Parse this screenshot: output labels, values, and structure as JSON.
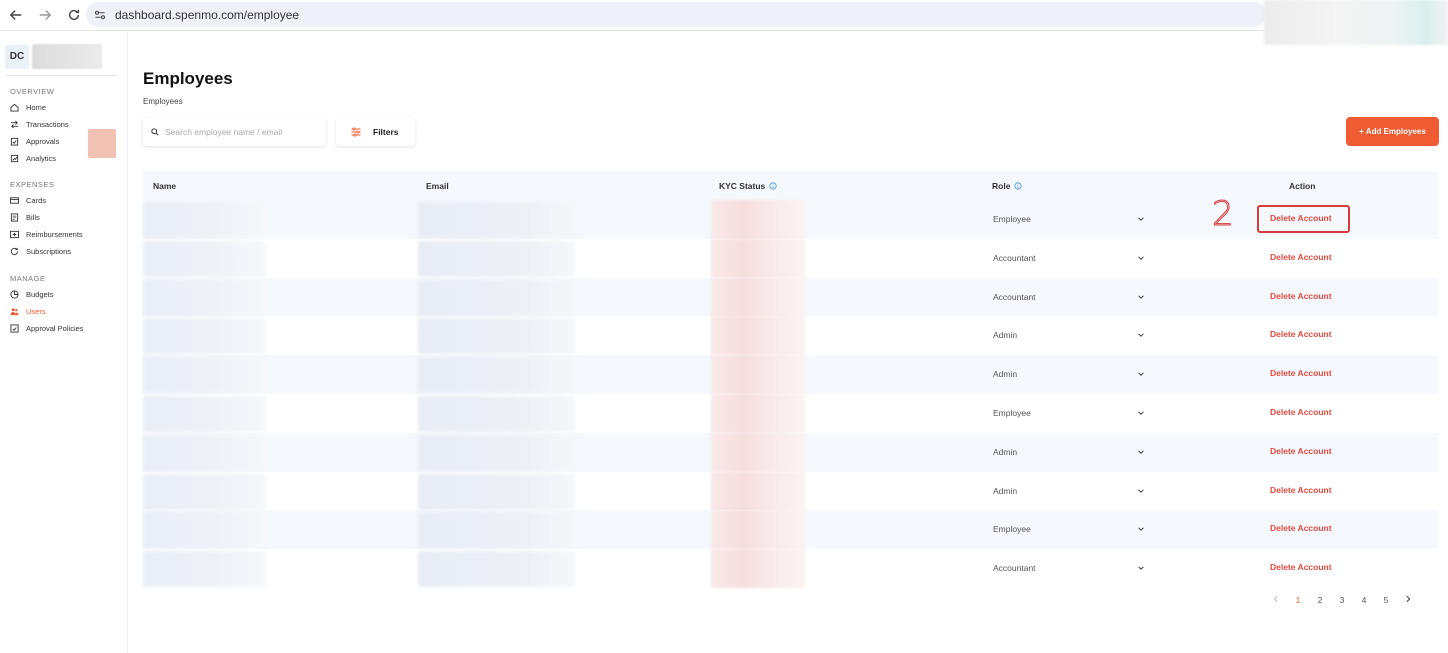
{
  "browser": {
    "url": "dashboard.spenmo.com/employee"
  },
  "sidebar": {
    "org_initials": "DC",
    "sections": [
      {
        "title": "OVERVIEW",
        "items": [
          {
            "label": "Home",
            "icon": "home-icon"
          },
          {
            "label": "Transactions",
            "icon": "transactions-icon"
          },
          {
            "label": "Approvals",
            "icon": "approvals-icon"
          },
          {
            "label": "Analytics",
            "icon": "analytics-icon"
          }
        ]
      },
      {
        "title": "EXPENSES",
        "items": [
          {
            "label": "Cards",
            "icon": "card-icon"
          },
          {
            "label": "Bills",
            "icon": "bills-icon"
          },
          {
            "label": "Reimbursements",
            "icon": "reimbursements-icon"
          },
          {
            "label": "Subscriptions",
            "icon": "subscriptions-icon"
          }
        ]
      },
      {
        "title": "MANAGE",
        "items": [
          {
            "label": "Budgets",
            "icon": "budgets-icon"
          },
          {
            "label": "Users",
            "icon": "users-icon",
            "active": true
          },
          {
            "label": "Approval Policies",
            "icon": "approval-policies-icon"
          }
        ]
      }
    ]
  },
  "main": {
    "title": "Employees",
    "breadcrumb": "Employees",
    "search_placeholder": "Search employee name / email",
    "filters_label": "Filters",
    "add_button_label": "+ Add Employees",
    "accent_color": "#ef5b32"
  },
  "table": {
    "headers": {
      "name": "Name",
      "email": "Email",
      "kyc": "KYC Status",
      "role": "Role",
      "action": "Action"
    },
    "rows": [
      {
        "role": "Employee",
        "action": "Delete Account"
      },
      {
        "role": "Accountant",
        "action": "Delete Account"
      },
      {
        "role": "Accountant",
        "action": "Delete Account"
      },
      {
        "role": "Admin",
        "action": "Delete Account"
      },
      {
        "role": "Admin",
        "action": "Delete Account"
      },
      {
        "role": "Employee",
        "action": "Delete Account"
      },
      {
        "role": "Admin",
        "action": "Delete Account"
      },
      {
        "role": "Admin",
        "action": "Delete Account"
      },
      {
        "role": "Employee",
        "action": "Delete Account"
      },
      {
        "role": "Accountant",
        "action": "Delete Account"
      }
    ]
  },
  "annotation": {
    "step_number": "2"
  },
  "pagination": {
    "pages": [
      "1",
      "2",
      "3",
      "4",
      "5"
    ],
    "current": "1"
  }
}
